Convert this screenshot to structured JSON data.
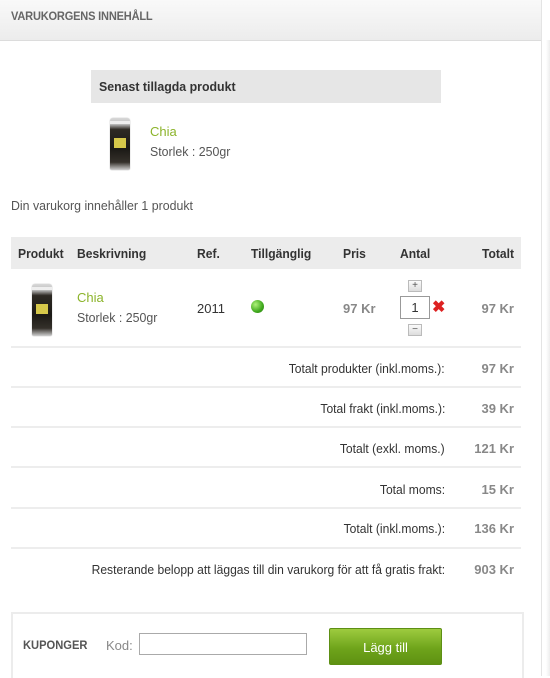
{
  "header": {
    "title": "VARUKORGENS INNEHÅLL"
  },
  "last_added": {
    "heading": "Senast tillagda produkt",
    "product_name": "Chia",
    "product_size": "Storlek : 250gr"
  },
  "cart_summary_text": "Din varukorg innehåller 1 produkt",
  "table": {
    "columns": [
      "Produkt",
      "Beskrivning",
      "Ref.",
      "Tillgänglig",
      "Pris",
      "Antal",
      "Totalt"
    ],
    "items": [
      {
        "name": "Chia",
        "size": "Storlek : 250gr",
        "ref": "2011",
        "availability": "in-stock",
        "price": "97 Kr",
        "quantity": "1",
        "total": "97 Kr",
        "qty_plus": "+",
        "qty_minus": "−",
        "delete": "✖"
      }
    ]
  },
  "totals": [
    {
      "label": "Totalt produkter (inkl.moms.):",
      "value": "97 Kr"
    },
    {
      "label": "Total frakt (inkl.moms.):",
      "value": "39 Kr"
    },
    {
      "label": "Totalt (exkl. moms.)",
      "value": "121 Kr"
    },
    {
      "label": "Total moms:",
      "value": "15 Kr"
    },
    {
      "label": "Totalt (inkl.moms.):",
      "value": "136 Kr"
    },
    {
      "label": "Resterande belopp att läggas till din varukorg för att få gratis frakt:",
      "value": "903 Kr"
    }
  ],
  "coupon": {
    "title": "KUPONGER",
    "code_label": "Kod:",
    "input_value": "",
    "button_label": "Lägg till"
  },
  "colors": {
    "product_link": "#8cb42b",
    "button_green": "#6fa41b",
    "availability_green": "#3fa81d",
    "delete_red": "#dd2222"
  }
}
